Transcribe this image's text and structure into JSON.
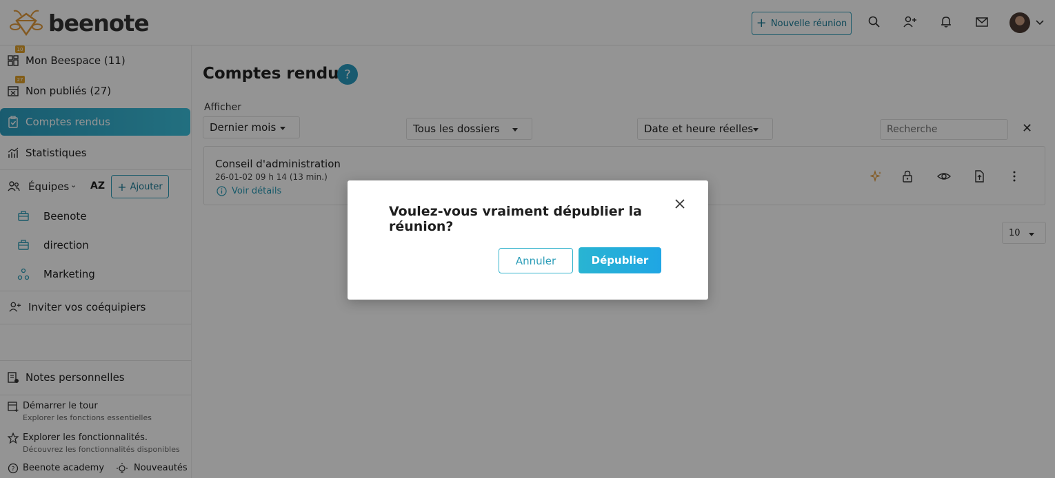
{
  "app": {
    "logo_text": "beenote"
  },
  "header": {
    "new_meeting_label": "Nouvelle réunion",
    "icons": [
      "search-icon",
      "add-user-icon",
      "bell-icon",
      "mail-icon",
      "avatar",
      "chevron-down-icon"
    ]
  },
  "sidebar": {
    "items": [
      {
        "label": "Mon Beespace (11)",
        "badge": "10",
        "icon": "dashboard-icon"
      },
      {
        "label": "Non publiés (27)",
        "badge": "27",
        "icon": "calendar-x-icon"
      },
      {
        "label": "Comptes rendus",
        "icon": "clipboard-check-icon",
        "active": true
      },
      {
        "label": "Statistiques",
        "icon": "chart-icon"
      }
    ],
    "teams_label": "Équipes",
    "sort_label": "AZ",
    "add_label": "Ajouter",
    "teams": [
      {
        "label": "Beenote",
        "icon": "briefcase-icon"
      },
      {
        "label": "direction",
        "icon": "briefcase-icon"
      },
      {
        "label": "Marketing",
        "icon": "network-icon"
      }
    ],
    "invite_label": "Inviter vos coéquipiers",
    "personal_notes_label": "Notes personnelles",
    "tour_title": "Démarrer le tour",
    "tour_subtitle": "Explorer les fonctions essentielles",
    "features_title": "Explorer les fonctionnalités.",
    "features_subtitle": "Découvrez les fonctionnalités disponibles",
    "academy_label": "Beenote academy",
    "news_label": "Nouveautés"
  },
  "main": {
    "title": "Comptes rendus",
    "help_label": "?",
    "show_label": "Afficher",
    "filter_period": "Dernier mois",
    "filter_folder": "Tous les dossiers",
    "filter_date": "Date et heure réelles",
    "search_placeholder": "Recherche",
    "card": {
      "title": "Conseil d'administration",
      "meta": "26-01-02 09 h 14 (13 min.)",
      "details_label": "Voir détails"
    },
    "page_size": "10"
  },
  "modal": {
    "question": "Voulez-vous vraiment dépublier la réunion?",
    "cancel_label": "Annuler",
    "confirm_label": "Dépublier"
  },
  "colors": {
    "accent": "#2a9cb7",
    "active_gradient_start": "#2c9ec0",
    "active_gradient_end": "#3cc0dc",
    "badge": "#e0a02a",
    "logo_orange": "#e29a3a"
  }
}
